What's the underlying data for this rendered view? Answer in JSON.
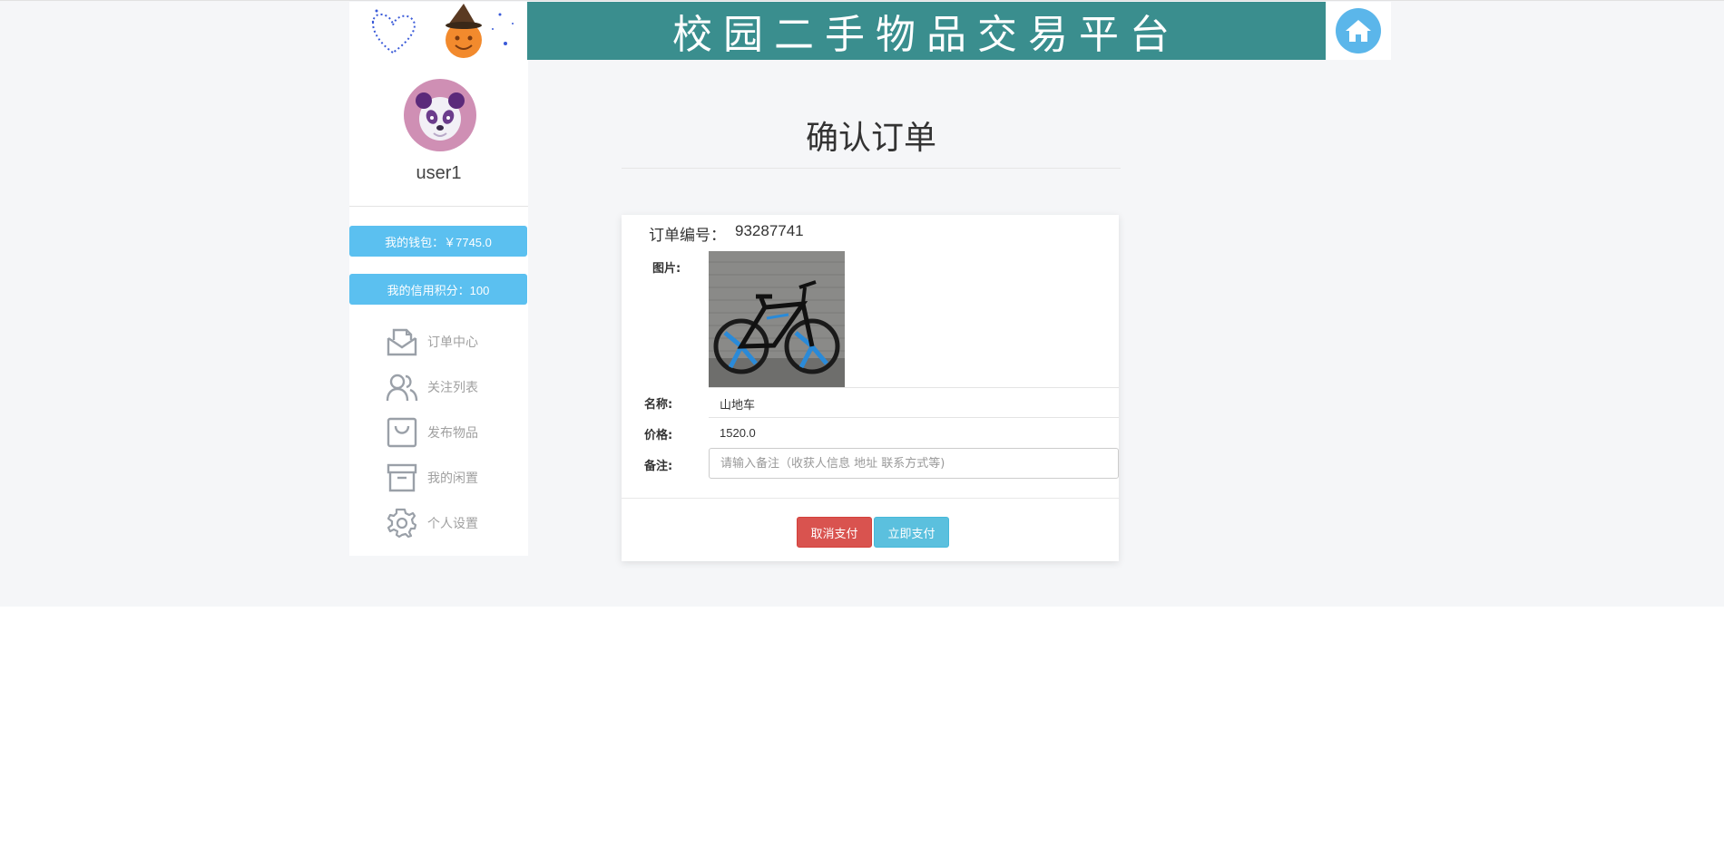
{
  "header": {
    "title": "校园二手物品交易平台",
    "home_icon": "home-icon"
  },
  "sidebar": {
    "username": "user1",
    "wallet_label": "我的钱包：￥7745.0",
    "credit_label": "我的信用积分：100",
    "nav": [
      {
        "label": "订单中心",
        "icon": "envelope-icon"
      },
      {
        "label": "关注列表",
        "icon": "users-icon"
      },
      {
        "label": "发布物品",
        "icon": "bag-icon"
      },
      {
        "label": "我的闲置",
        "icon": "archive-icon"
      },
      {
        "label": "个人设置",
        "icon": "gear-icon"
      }
    ]
  },
  "main": {
    "page_title": "确认订单",
    "order": {
      "order_no_label": "订单编号：",
      "order_no": "93287741",
      "image_label": "图片:",
      "name_label": "名称:",
      "name": "山地车",
      "price_label": "价格:",
      "price": "1520.0",
      "remark_label": "备注:",
      "remark_value": "",
      "remark_placeholder": "请输入备注（收获人信息 地址 联系方式等)"
    },
    "buttons": {
      "cancel": "取消支付",
      "pay": "立即支付"
    }
  },
  "colors": {
    "banner": "#3a8e8e",
    "primary": "#5bc0f0",
    "danger": "#d9534f",
    "info": "#5bc0de",
    "home": "#5bb6ea"
  }
}
